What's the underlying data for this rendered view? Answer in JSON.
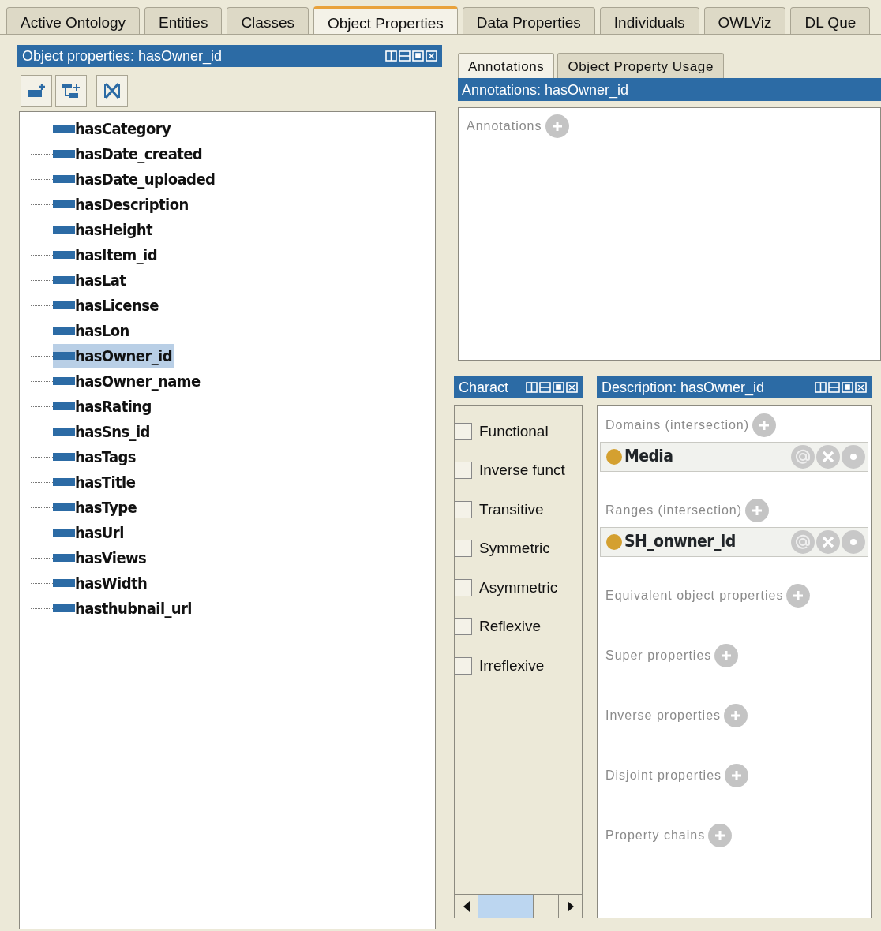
{
  "tabs": [
    {
      "label": "Active Ontology",
      "selected": false
    },
    {
      "label": "Entities",
      "selected": false
    },
    {
      "label": "Classes",
      "selected": false
    },
    {
      "label": "Object Properties",
      "selected": true
    },
    {
      "label": "Data Properties",
      "selected": false
    },
    {
      "label": "Individuals",
      "selected": false
    },
    {
      "label": "OWLViz",
      "selected": false
    },
    {
      "label": "DL Que",
      "selected": false
    }
  ],
  "object_properties_panel": {
    "title": "Object properties: hasOwner_id",
    "tree": [
      {
        "label": "hasCategory",
        "selected": false
      },
      {
        "label": "hasDate_created",
        "selected": false
      },
      {
        "label": "hasDate_uploaded",
        "selected": false
      },
      {
        "label": "hasDescription",
        "selected": false
      },
      {
        "label": "hasHeight",
        "selected": false
      },
      {
        "label": "hasItem_id",
        "selected": false
      },
      {
        "label": "hasLat",
        "selected": false
      },
      {
        "label": "hasLicense",
        "selected": false
      },
      {
        "label": "hasLon",
        "selected": false
      },
      {
        "label": "hasOwner_id",
        "selected": true
      },
      {
        "label": "hasOwner_name",
        "selected": false
      },
      {
        "label": "hasRating",
        "selected": false
      },
      {
        "label": "hasSns_id",
        "selected": false
      },
      {
        "label": "hasTags",
        "selected": false
      },
      {
        "label": "hasTitle",
        "selected": false
      },
      {
        "label": "hasType",
        "selected": false
      },
      {
        "label": "hasUrl",
        "selected": false
      },
      {
        "label": "hasViews",
        "selected": false
      },
      {
        "label": "hasWidth",
        "selected": false
      },
      {
        "label": "hasthubnail_url",
        "selected": false
      }
    ]
  },
  "annotations_panel": {
    "tabs": [
      {
        "label": "Annotations",
        "selected": true
      },
      {
        "label": "Object Property Usage",
        "selected": false
      }
    ],
    "header": "Annotations: hasOwner_id",
    "annotations_label": "Annotations"
  },
  "characteristics_panel": {
    "title": "Charact",
    "items": [
      {
        "label": "Functional",
        "checked": false
      },
      {
        "label": "Inverse funct",
        "checked": false
      },
      {
        "label": "Transitive",
        "checked": false
      },
      {
        "label": "Symmetric",
        "checked": false
      },
      {
        "label": "Asymmetric",
        "checked": false
      },
      {
        "label": "Reflexive",
        "checked": false
      },
      {
        "label": "Irreflexive",
        "checked": false
      }
    ]
  },
  "description_panel": {
    "title": "Description: hasOwner_id",
    "sections": [
      {
        "label": "Domains (intersection)",
        "entries": [
          {
            "label": "Media"
          }
        ]
      },
      {
        "label": "Ranges (intersection)",
        "entries": [
          {
            "label": "SH_onwner_id"
          }
        ]
      },
      {
        "label": "Equivalent object properties"
      },
      {
        "label": "Super properties"
      },
      {
        "label": "Inverse properties"
      },
      {
        "label": "Disjoint properties"
      },
      {
        "label": "Property chains"
      }
    ]
  }
}
